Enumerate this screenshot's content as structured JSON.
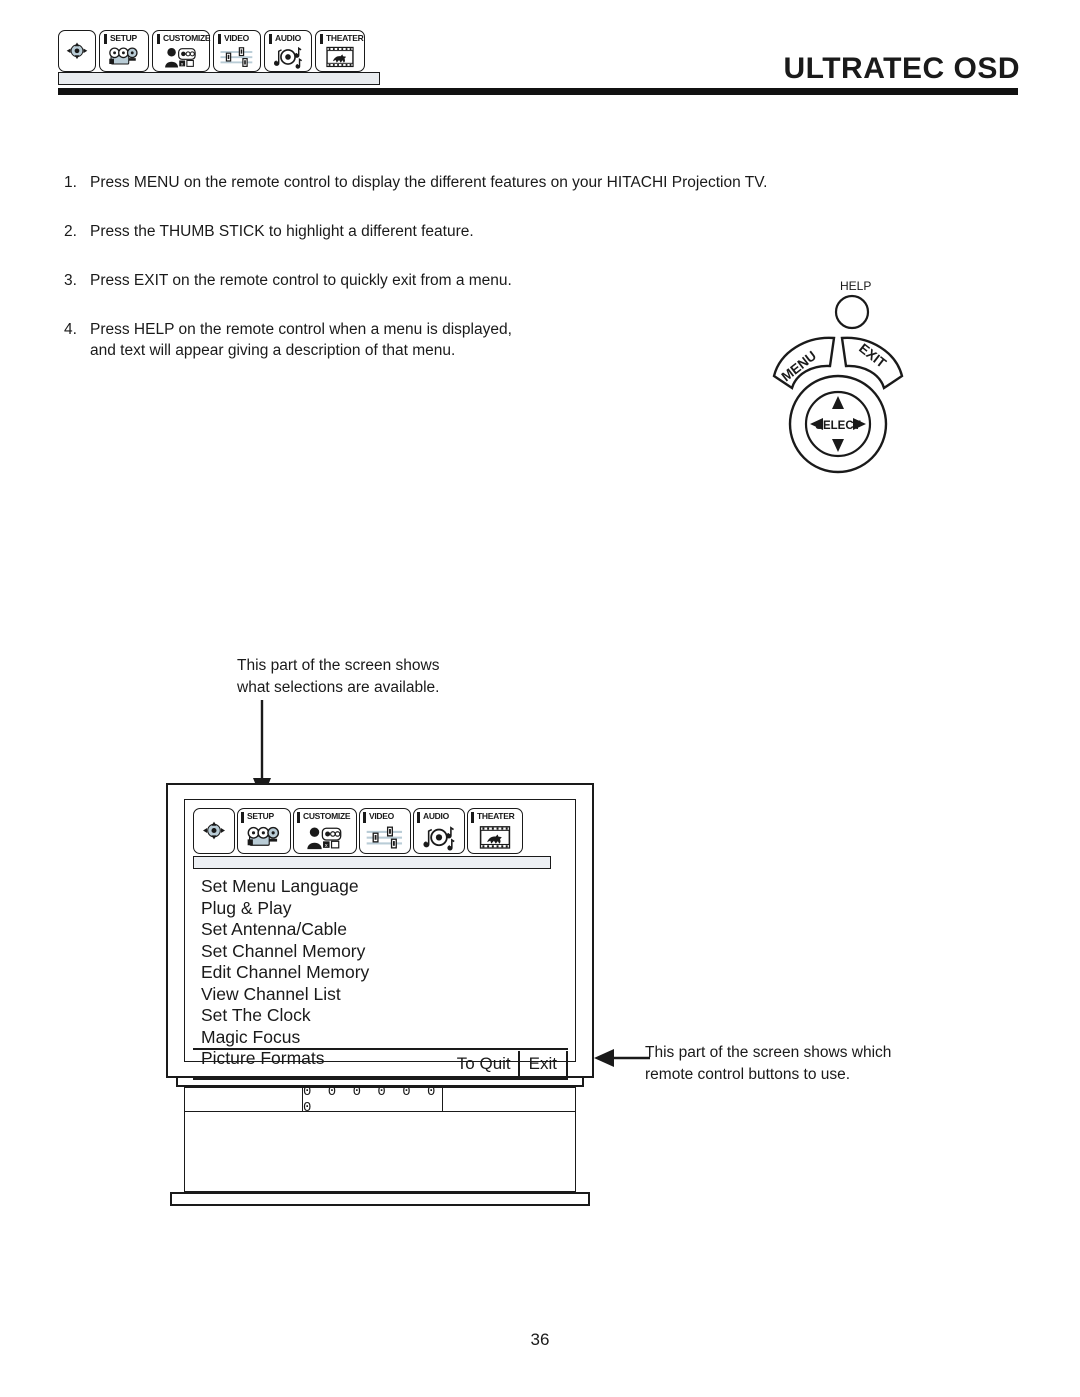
{
  "header": {
    "title": "ULTRATEC OSD",
    "tabs": [
      {
        "label": "",
        "icon": "thumbstick-icon"
      },
      {
        "label": "SETUP",
        "icon": "setup-camera-icon"
      },
      {
        "label": "CUSTOMIZE",
        "icon": "customize-person-icon"
      },
      {
        "label": "VIDEO",
        "icon": "video-sliders-icon"
      },
      {
        "label": "AUDIO",
        "icon": "audio-note-icon"
      },
      {
        "label": "THEATER",
        "icon": "theater-film-icon"
      }
    ]
  },
  "instructions": [
    {
      "num": "1.",
      "text": "Press MENU on the remote control to display the different features on your HITACHI Projection TV."
    },
    {
      "num": "2.",
      "text": "Press the THUMB STICK to highlight a different feature."
    },
    {
      "num": "3.",
      "text": "Press EXIT on the remote control to quickly exit from a menu."
    },
    {
      "num": "4.",
      "text": "Press HELP on the remote control when a menu is displayed,\nand text will appear giving a description of that menu."
    }
  ],
  "remote": {
    "help_label": "HELP",
    "menu_label": "MENU",
    "exit_label": "EXIT",
    "select_label": "SELECT"
  },
  "callouts": {
    "top": "This part of the screen shows\nwhat selections are available.",
    "right": "This part of the screen shows which\nremote control buttons to use."
  },
  "tv": {
    "osd_tabs": [
      {
        "label": "",
        "icon": "thumbstick-icon"
      },
      {
        "label": "SETUP",
        "icon": "setup-camera-icon"
      },
      {
        "label": "CUSTOMIZE",
        "icon": "customize-person-icon"
      },
      {
        "label": "VIDEO",
        "icon": "video-sliders-icon"
      },
      {
        "label": "AUDIO",
        "icon": "audio-note-icon"
      },
      {
        "label": "THEATER",
        "icon": "theater-film-icon"
      }
    ],
    "menu_items": [
      "Set Menu Language",
      "Plug & Play",
      "Set Antenna/Cable",
      "Set Channel Memory",
      "Edit Channel Memory",
      "View Channel List",
      "Set The Clock",
      "Magic Focus",
      "Picture Formats"
    ],
    "footer": {
      "to_quit": "To Quit",
      "exit": "Exit"
    },
    "panel_indicators": "0 0 0 0 0 0 0"
  },
  "page_number": "36",
  "colors": {
    "ink": "#1a1a1a",
    "gray_bar": "#e9ecef",
    "icon_fill": "#b9ccd6"
  }
}
